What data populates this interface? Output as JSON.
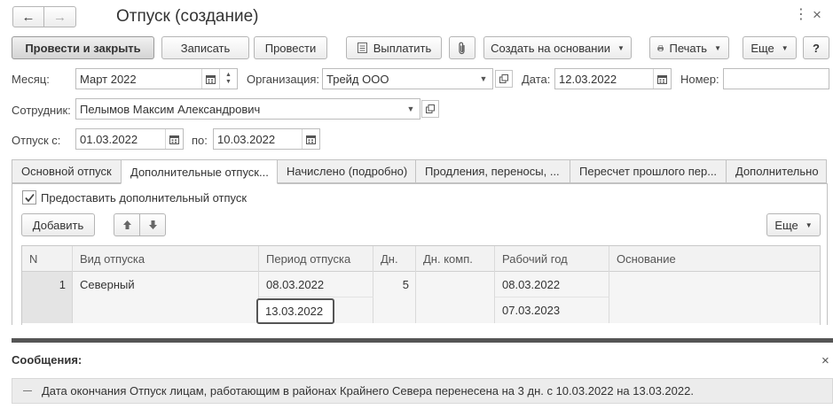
{
  "window": {
    "title": "Отпуск (создание)"
  },
  "toolbar": {
    "post_close": "Провести и закрыть",
    "save": "Записать",
    "post": "Провести",
    "pay": "Выплатить",
    "create_based": "Создать на основании",
    "print": "Печать",
    "more": "Еще",
    "help": "?"
  },
  "form": {
    "month_label": "Месяц:",
    "month_value": "Март 2022",
    "org_label": "Организация:",
    "org_value": "Трейд ООО",
    "date_label": "Дата:",
    "date_value": "12.03.2022",
    "number_label": "Номер:",
    "number_value": "",
    "employee_label": "Сотрудник:",
    "employee_value": "Пелымов Максим Александрович",
    "vac_from_label": "Отпуск с:",
    "vac_from_value": "01.03.2022",
    "vac_to_label": "по:",
    "vac_to_value": "10.03.2022"
  },
  "tabs": [
    {
      "label": "Основной отпуск"
    },
    {
      "label": "Дополнительные отпуск..."
    },
    {
      "label": "Начислено (подробно)"
    },
    {
      "label": "Продления, переносы, ..."
    },
    {
      "label": "Пересчет прошлого пер..."
    },
    {
      "label": "Дополнительно"
    }
  ],
  "panel": {
    "checkbox_label": "Предоставить дополнительный отпуск",
    "checkbox_checked": true,
    "add": "Добавить",
    "more": "Еще"
  },
  "table": {
    "columns": [
      "N",
      "Вид отпуска",
      "Период отпуска",
      "Дн.",
      "Дн. комп.",
      "Рабочий год",
      "Основание"
    ],
    "rows": [
      {
        "n": "1",
        "type": "Северный",
        "period_start": "08.03.2022",
        "period_end": "13.03.2022",
        "days": "5",
        "comp_days": "",
        "work_year_start": "08.03.2022",
        "work_year_end": "07.03.2023",
        "basis": ""
      }
    ]
  },
  "messages": {
    "title": "Сообщения:",
    "items": [
      {
        "text": "Дата окончания Отпуск лицам, работающим в районах Крайнего Севера перенесена на 3 дн. с 10.03.2022 на 13.03.2022."
      }
    ]
  }
}
